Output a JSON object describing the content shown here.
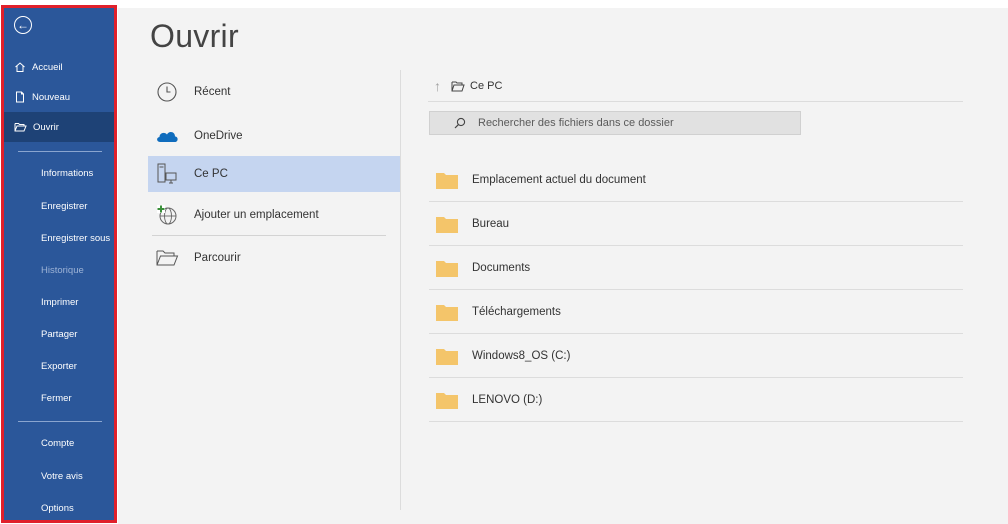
{
  "sidebar": {
    "back_icon": "arrow-left-circle-icon",
    "top_items": [
      {
        "label": "Accueil",
        "icon": "home-icon"
      },
      {
        "label": "Nouveau",
        "icon": "new-document-icon"
      },
      {
        "label": "Ouvrir",
        "icon": "open-folder-icon",
        "active": true
      }
    ],
    "items": [
      {
        "label": "Informations"
      },
      {
        "label": "Enregistrer"
      },
      {
        "label": "Enregistrer sous"
      },
      {
        "label": "Historique",
        "disabled": true
      },
      {
        "label": "Imprimer"
      },
      {
        "label": "Partager"
      },
      {
        "label": "Exporter"
      },
      {
        "label": "Fermer"
      }
    ],
    "bottom_items": [
      {
        "label": "Compte"
      },
      {
        "label": "Votre avis"
      },
      {
        "label": "Options"
      }
    ]
  },
  "main": {
    "title": "Ouvrir",
    "locations": [
      {
        "label": "Récent",
        "icon": "clock-icon"
      },
      {
        "label": "OneDrive",
        "icon": "cloud-icon"
      },
      {
        "label": "Ce PC",
        "icon": "pc-icon",
        "selected": true
      },
      {
        "label": "Ajouter un emplacement",
        "icon": "add-place-icon"
      },
      {
        "label": "Parcourir",
        "icon": "folder-open-icon"
      }
    ],
    "path": {
      "label": "Ce PC"
    },
    "search": {
      "placeholder": "Rechercher des fichiers dans ce dossier"
    },
    "folders": [
      {
        "name": "Emplacement actuel du document"
      },
      {
        "name": "Bureau"
      },
      {
        "name": "Documents"
      },
      {
        "name": "Téléchargements"
      },
      {
        "name": "Windows8_OS (C:)"
      },
      {
        "name": "LENOVO (D:)"
      }
    ]
  },
  "colors": {
    "sidebar_bg": "#2b579a",
    "sidebar_active": "#1e4276",
    "highlight_border": "#e0202b",
    "selected_location": "#c5d5f0",
    "folder": "#f4c56a",
    "onedrive": "#0f6cbd"
  }
}
